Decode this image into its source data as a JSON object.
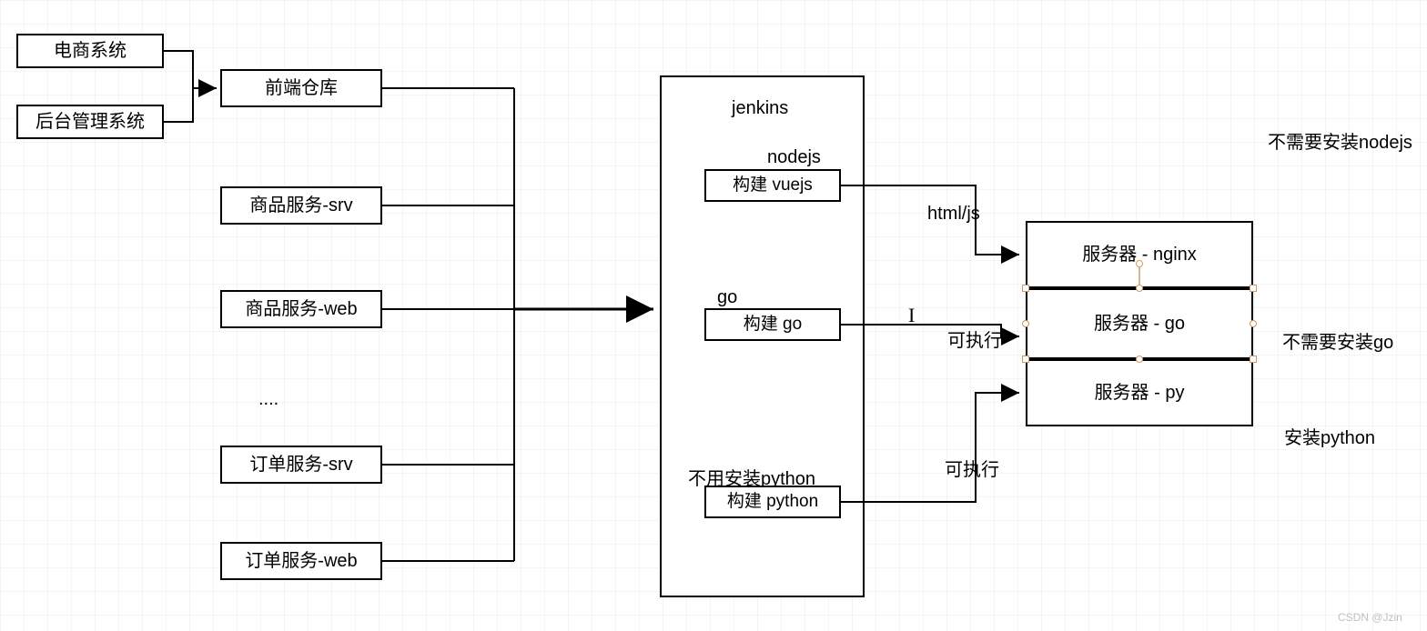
{
  "nodes": {
    "ecommerce": "电商系统",
    "admin": "后台管理系统",
    "frontend_repo": "前端仓库",
    "product_srv": "商品服务-srv",
    "product_web": "商品服务-web",
    "ellipsis": "....",
    "order_srv": "订单服务-srv",
    "order_web": "订单服务-web",
    "jenkins_title": "jenkins",
    "nodejs_label": "nodejs",
    "build_vue": "构建 vuejs",
    "go_label": "go",
    "build_go": "构建 go",
    "no_install_python": "不用安装python",
    "build_python": "构建 python",
    "server_nginx": "服务器 - nginx",
    "server_go": "服务器 - go",
    "server_py": "服务器 - py",
    "edge_htmljs": "html/js",
    "edge_exec1": "可执行",
    "edge_exec2": "可执行",
    "note_nodejs": "不需要安装nodejs",
    "note_go": "不需要安装go",
    "note_py": "安装python",
    "watermark": "CSDN @Jzin"
  }
}
